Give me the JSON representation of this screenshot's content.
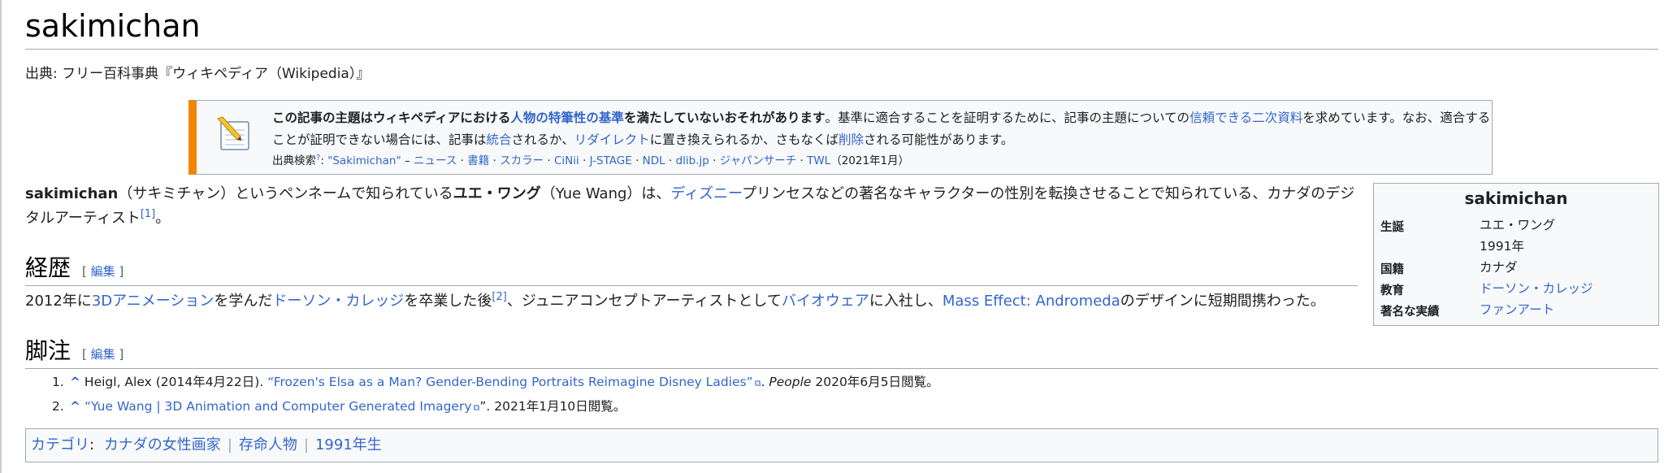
{
  "article": {
    "title": "sakimichan",
    "from": "出典: フリー百科事典『ウィキペディア（Wikipedia）』"
  },
  "notice": {
    "icon": "edit-pencil-notepad-icon",
    "accent_color": "#f28500",
    "bold_1": "この記事の主題はウィキペディアにおける",
    "bold_link": "人物の特筆性の基準",
    "bold_2": "を満たしていないおそれがあります",
    "t1": "。基準に適合することを証明するために、記事の主題についての",
    "link_secondary": "信頼できる二次資料",
    "t2": "を求めています。なお、適合することが証明できない場合には、記事は",
    "link_merge": "統合",
    "t3": "されるか、",
    "link_redirect": "リダイレクト",
    "t4": "に置き換えられるか、さもなくば",
    "link_delete": "削除",
    "t5": "される可能性があります。",
    "search_label": "出典検索",
    "search_sup": "?",
    "search_query": "\"Sakimichan\"",
    "dash": " – ",
    "search_links": [
      "ニュース",
      "書籍",
      "スカラー",
      "CiNii",
      "J-STAGE",
      "NDL",
      "dlib.jp",
      "ジャパンサーチ",
      "TWL"
    ],
    "search_date": "（2021年1月）"
  },
  "lead": {
    "b1": "sakimichan",
    "t1": "（サキミチャン）というペンネームで知られている",
    "b2": "ユエ・ワング",
    "t2": "（Yue Wang）は、",
    "link_disney": "ディズニー",
    "t3": "プリンセスなどの著名なキャラクターの性別を転換させることで知られている、カナダのデジタルアーティスト",
    "ref": "[1]",
    "t4": "。"
  },
  "infobox": {
    "title": "sakimichan",
    "rows": [
      {
        "label": "生誕",
        "value": "ユエ・ワング",
        "value2": "1991年"
      },
      {
        "label": "国籍",
        "value": "カナダ"
      },
      {
        "label": "教育",
        "value": "ドーソン・カレッジ"
      },
      {
        "label": "著名な実績",
        "value": "ファンアート"
      }
    ]
  },
  "sections": {
    "career": {
      "heading": "経歴",
      "edit": "編集",
      "t1": "2012年に",
      "link_3d": "3Dアニメーション",
      "t2": "を学んだ",
      "link_dawson": "ドーソン・カレッジ",
      "t3": "を卒業した後",
      "ref": "[2]",
      "t4": "、ジュニアコンセプトアーティストとして",
      "link_bioware": "バイオウェア",
      "t5": "に入社し、",
      "link_mass": "Mass Effect: Andromeda",
      "t6": "のデザインに短期間携わった。"
    },
    "notes": {
      "heading": "脚注",
      "edit": "編集",
      "refs": [
        {
          "num": "1.",
          "caret": "^",
          "pre": " Heigl, Alex (2014年4月22日). ",
          "link": "“Frozen's Elsa as a Man? Gender-Bending Portraits Reimagine Disney Ladies”",
          "mid": ". ",
          "italic": "People",
          "post": " 2020年6月5日閲覧。"
        },
        {
          "num": "2.",
          "caret": "^",
          "pre": " ",
          "link": "“Yue Wang | 3D Animation and Computer Generated Imagery",
          "mid": "”. 2021年1月10日閲覧。",
          "italic": "",
          "post": ""
        }
      ]
    }
  },
  "categories": {
    "label": "カテゴリ",
    "colon": ":",
    "items": [
      "カナダの女性画家",
      "存命人物",
      "1991年生"
    ]
  }
}
